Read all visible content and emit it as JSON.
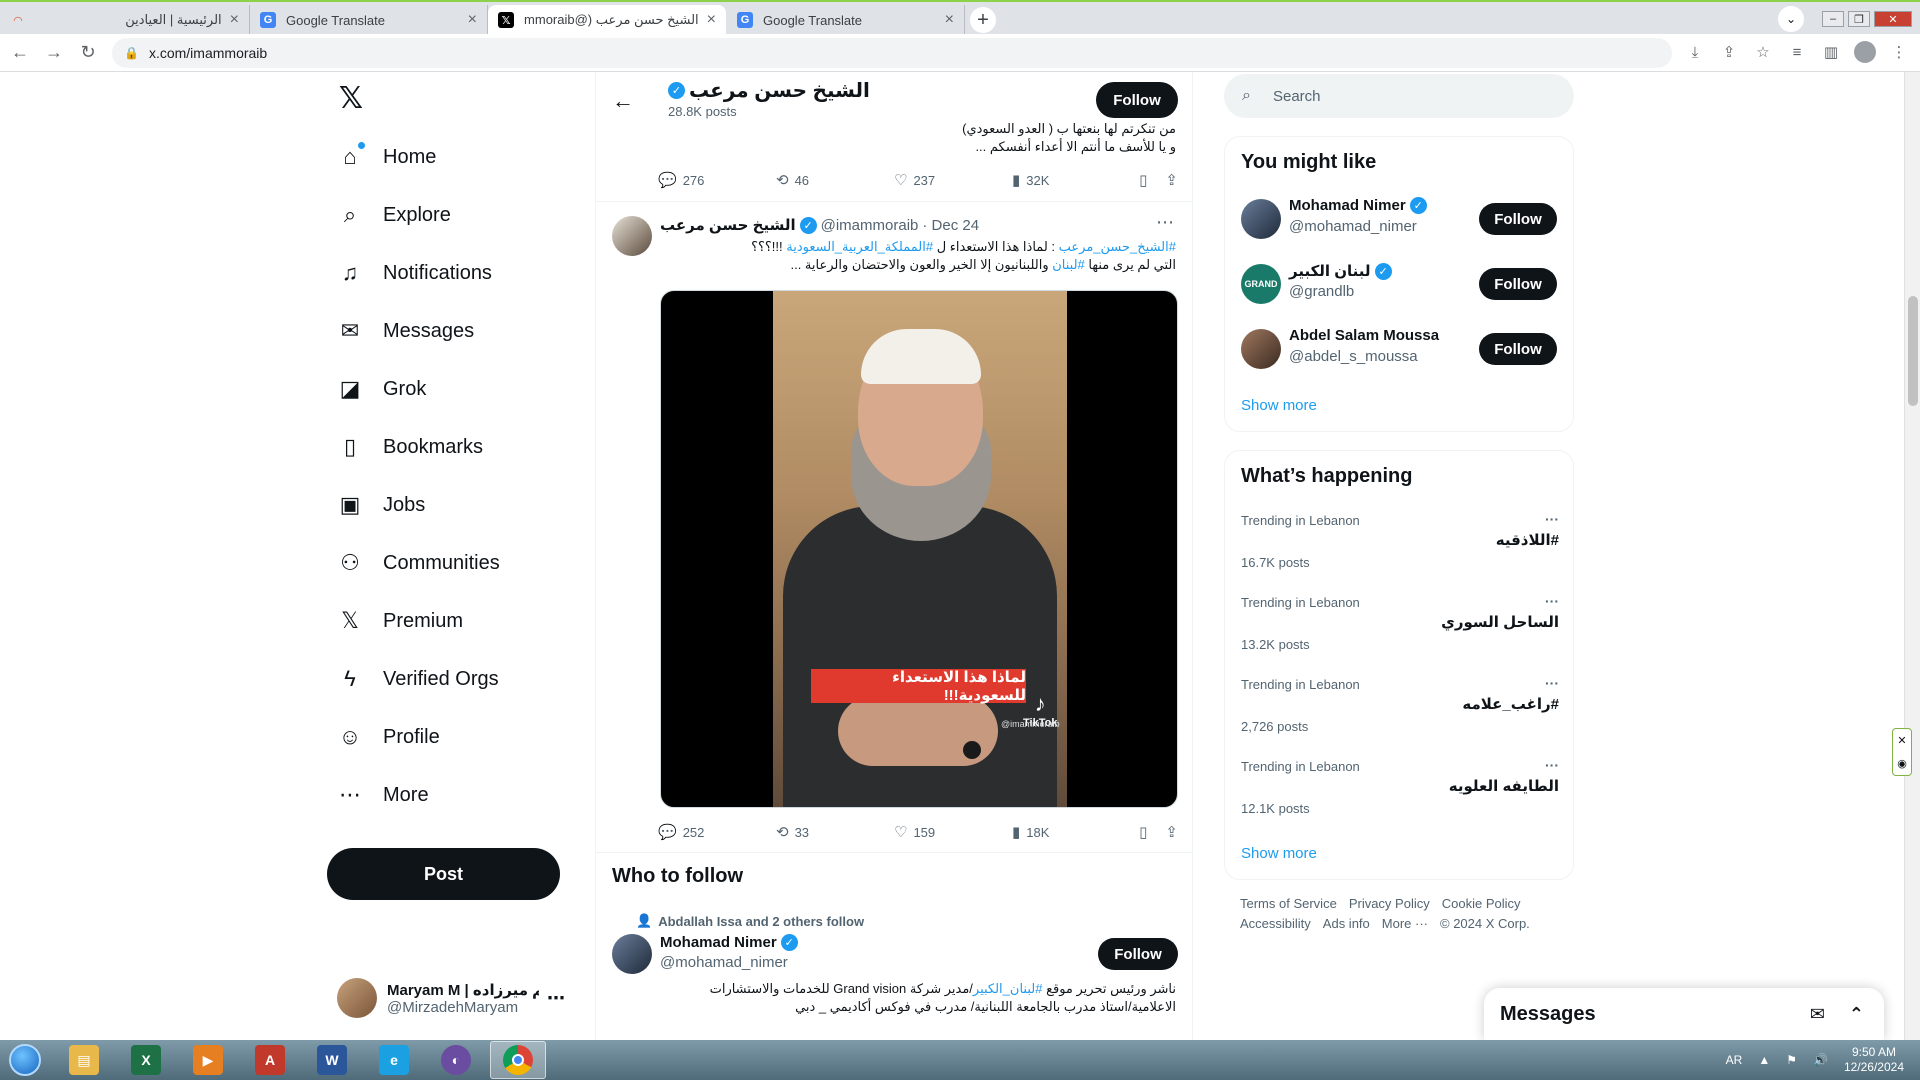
{
  "tabs": [
    {
      "title": "الرئيسية | العيادين",
      "icon": "orange-logo-icon"
    },
    {
      "title": "Google Translate",
      "icon": "google-translate-icon"
    },
    {
      "title": "الشيخ حسن مرعب (@imammoraib",
      "icon": "x-icon",
      "active": true
    },
    {
      "title": "Google Translate",
      "icon": "google-translate-icon"
    }
  ],
  "url": "x.com/imammoraib",
  "nav": {
    "items": [
      {
        "key": "home",
        "label": "Home",
        "icon": "⌂"
      },
      {
        "key": "explore",
        "label": "Explore",
        "icon": "⌕"
      },
      {
        "key": "notifications",
        "label": "Notifications",
        "icon": "🔔"
      },
      {
        "key": "messages",
        "label": "Messages",
        "icon": "✉"
      },
      {
        "key": "grok",
        "label": "Grok",
        "icon": "◪"
      },
      {
        "key": "bookmarks",
        "label": "Bookmarks",
        "icon": "🔖"
      },
      {
        "key": "jobs",
        "label": "Jobs",
        "icon": "💼"
      },
      {
        "key": "communities",
        "label": "Communities",
        "icon": "👥"
      },
      {
        "key": "premium",
        "label": "Premium",
        "icon": "𝕏"
      },
      {
        "key": "verified-orgs",
        "label": "Verified Orgs",
        "icon": "ϟ"
      },
      {
        "key": "profile",
        "label": "Profile",
        "icon": "👤"
      },
      {
        "key": "more",
        "label": "More",
        "icon": "⋯"
      }
    ],
    "post_label": "Post"
  },
  "account": {
    "name": "Maryam M | مریم میرزاده",
    "handle": "@MirzadehMaryam"
  },
  "header": {
    "name": "الشيخ حسن مرعب",
    "posts": "28.8K posts",
    "follow": "Follow"
  },
  "prev_tweet": {
    "line1": "من تنكرتم لها بنعتها ب ( العدو السعودي)",
    "line2": "و يا للأسف ما أنتم الا أعداء أنفسكم ...",
    "replies": "276",
    "reposts": "46",
    "likes": "237",
    "views": "32K"
  },
  "tweet": {
    "name": "الشيخ حسن مرعب",
    "handle": "@imammoraib",
    "date": "· Dec 24",
    "line1_tag1": "#الشيخ_حسن_مرعب",
    "line1_mid": ": لماذا هذا الاستعداء ل",
    "line1_tag2": "#المملكة_العربية_السعودية",
    "line1_end": "!!!؟؟؟",
    "line2_pre": "التي لم يرى منها",
    "line2_tag": "#لبنان",
    "line2_post": "واللبنانيون إلا الخير والعون والاحتضان والرعاية ...",
    "video_caption": "لماذا هذا الاستعداء للسعودية!!!",
    "tiktok_label": "TikTok",
    "tiktok_handle": "@imammoraib",
    "replies": "252",
    "reposts": "33",
    "likes": "159",
    "views": "18K"
  },
  "who_to_follow": {
    "title": "Who to follow",
    "social": "Abdallah Issa and 2 others follow",
    "name": "Mohamad Nimer",
    "handle": "@mohamad_nimer",
    "follow": "Follow",
    "bio_pre": "ناشر ورئيس تحرير موقع",
    "bio_tag": "#لبنان_الكبير",
    "bio_post": "/مدير شركة Grand vision للخدمات والاستشارات",
    "bio_line2": "الاعلامية/استاذ مدرب بالجامعة اللبنانية/ مدرب في فوكس أكاديمي _ دبي"
  },
  "search": {
    "placeholder": "Search"
  },
  "you_might_like": {
    "title": "You might like",
    "items": [
      {
        "name": "Mohamad Nimer",
        "handle": "@mohamad_nimer",
        "follow": "Follow"
      },
      {
        "name": "لبنان الكبير",
        "handle": "@grandlb",
        "follow": "Follow"
      },
      {
        "name": "Abdel Salam Moussa",
        "handle": "@abdel_s_moussa",
        "follow": "Follow"
      }
    ],
    "show_more": "Show more"
  },
  "whats_happening": {
    "title": "What’s happening",
    "items": [
      {
        "context": "Trending in Lebanon",
        "name": "#اللاذقيه",
        "count": "16.7K posts"
      },
      {
        "context": "Trending in Lebanon",
        "name": "الساحل السوري",
        "count": "13.2K posts"
      },
      {
        "context": "Trending in Lebanon",
        "name": "#راغب_علامه",
        "count": "2,726 posts"
      },
      {
        "context": "Trending in Lebanon",
        "name": "الطايفه العلويه",
        "count": "12.1K posts"
      }
    ],
    "show_more": "Show more"
  },
  "footer": {
    "terms": "Terms of Service",
    "privacy": "Privacy Policy",
    "cookie": "Cookie Policy",
    "accessibility": "Accessibility",
    "ads": "Ads info",
    "more": "More ···",
    "copyright": "© 2024 X Corp."
  },
  "messages_drawer": {
    "title": "Messages"
  },
  "taskbar": {
    "lang": "AR",
    "time": "9:50 AM",
    "date": "12/26/2024"
  },
  "colors": {
    "accent": "#1d9bf0",
    "hashtag": "#1d9bf0",
    "caption_red": "#e03a2f"
  }
}
